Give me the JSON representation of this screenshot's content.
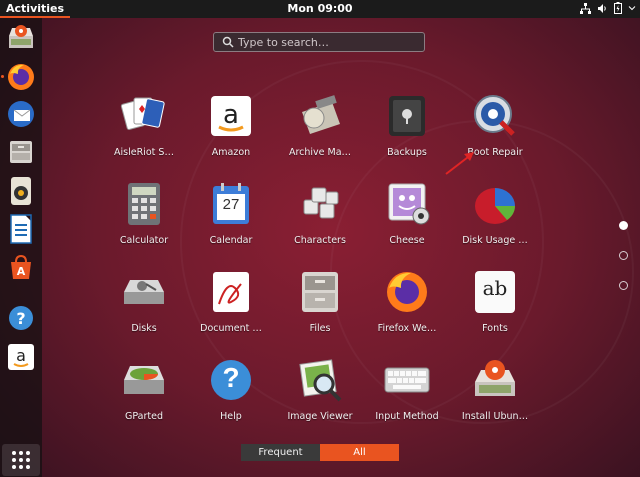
{
  "topbar": {
    "activities": "Activities",
    "clock": "Mon 09:00"
  },
  "search": {
    "placeholder": "Type to search…"
  },
  "apps": [
    {
      "label": "AisleRiot S…",
      "icon": "cards-icon"
    },
    {
      "label": "Amazon",
      "icon": "amazon-icon"
    },
    {
      "label": "Archive Ma…",
      "icon": "archive-manager-icon"
    },
    {
      "label": "Backups",
      "icon": "backups-safe-icon"
    },
    {
      "label": "Boot Repair",
      "icon": "boot-repair-icon"
    },
    {
      "label": "Calculator",
      "icon": "calculator-icon"
    },
    {
      "label": "Calendar",
      "icon": "calendar-icon",
      "day": "27"
    },
    {
      "label": "Characters",
      "icon": "characters-icon"
    },
    {
      "label": "Cheese",
      "icon": "cheese-webcam-icon"
    },
    {
      "label": "Disk Usage …",
      "icon": "disk-usage-pie-icon"
    },
    {
      "label": "Disks",
      "icon": "disks-icon"
    },
    {
      "label": "Document …",
      "icon": "document-viewer-icon"
    },
    {
      "label": "Files",
      "icon": "files-cabinet-icon"
    },
    {
      "label": "Firefox We…",
      "icon": "firefox-icon"
    },
    {
      "label": "Fonts",
      "icon": "fonts-icon",
      "glyphs": "ab"
    },
    {
      "label": "GParted",
      "icon": "gparted-icon"
    },
    {
      "label": "Help",
      "icon": "help-icon",
      "glyph": "?"
    },
    {
      "label": "Image Viewer",
      "icon": "image-viewer-icon"
    },
    {
      "label": "Input Method",
      "icon": "keyboard-icon"
    },
    {
      "label": "Install Ubun…",
      "icon": "install-ubuntu-icon"
    }
  ],
  "dock": [
    {
      "name": "dock-install-ubuntu",
      "icon": "install-ubuntu-icon"
    },
    {
      "name": "dock-firefox",
      "icon": "firefox-icon"
    },
    {
      "name": "dock-thunderbird",
      "icon": "thunderbird-icon"
    },
    {
      "name": "dock-files",
      "icon": "files-cabinet-icon"
    },
    {
      "name": "dock-rhythmbox",
      "icon": "rhythmbox-icon"
    },
    {
      "name": "dock-writer",
      "icon": "libreoffice-writer-icon"
    },
    {
      "name": "dock-software",
      "icon": "ubuntu-software-icon"
    },
    {
      "name": "dock-help",
      "icon": "help-icon"
    },
    {
      "name": "dock-amazon",
      "icon": "amazon-icon"
    }
  ],
  "tabs": {
    "frequent": "Frequent",
    "all": "All"
  },
  "colors": {
    "accent": "#e95420",
    "topbar": "#1b1b1b"
  }
}
